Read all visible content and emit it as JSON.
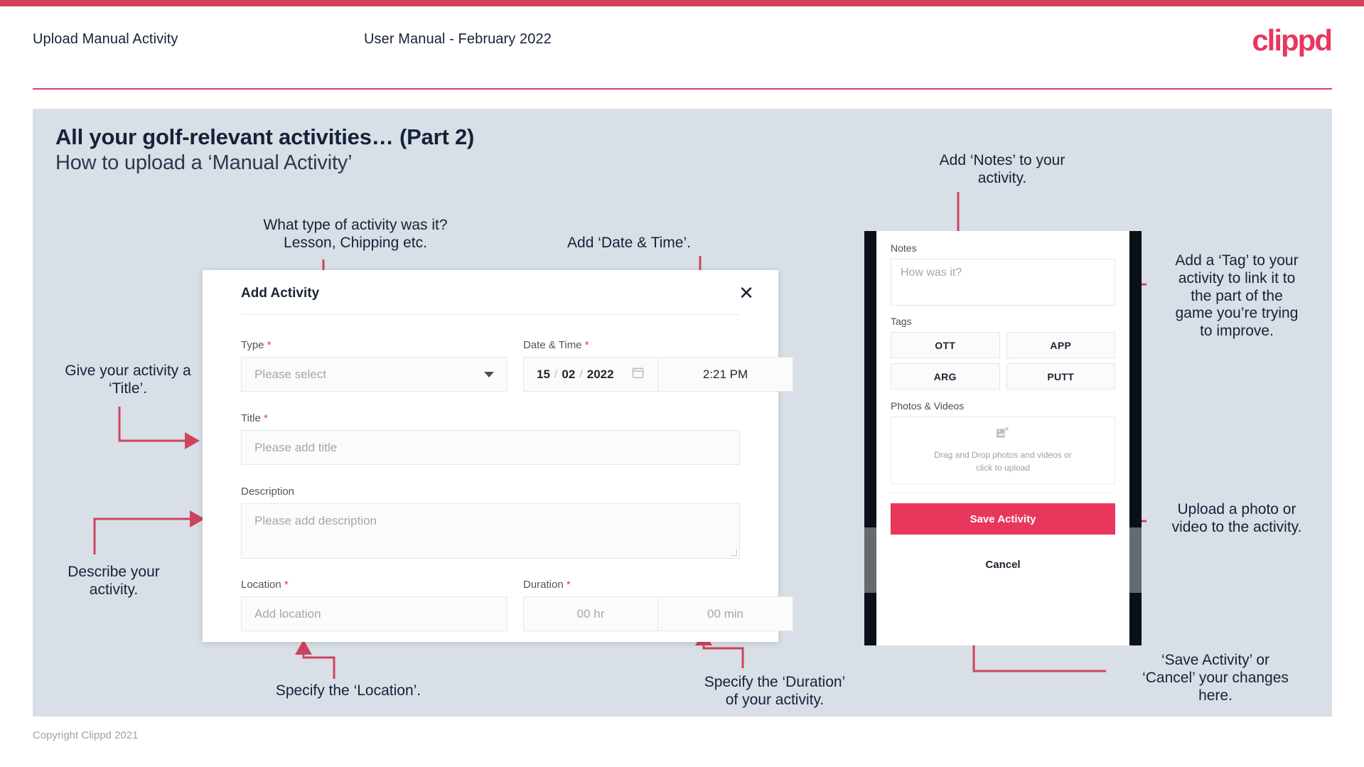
{
  "header": {
    "title": "Upload Manual Activity",
    "subtitle": "User Manual - February 2022",
    "logo": "clippd"
  },
  "slide": {
    "title": "All your golf-relevant activities… (Part 2)",
    "subtitle": "How to upload a ‘Manual Activity’"
  },
  "footer": {
    "copyright": "Copyright Clippd 2021"
  },
  "annotations": {
    "type": "What type of activity was it?\nLesson, Chipping etc.",
    "date_time": "Add ‘Date & Time’.",
    "title": "Give your activity a\n‘Title’.",
    "describe": "Describe your\nactivity.",
    "location": "Specify the ‘Location’.",
    "duration": "Specify the ‘Duration’\nof your activity.",
    "notes": "Add ‘Notes’ to your\nactivity.",
    "tag": "Add a ‘Tag’ to your\nactivity to link it to\nthe part of the\ngame you’re trying\nto improve.",
    "upload": "Upload a photo or\nvideo to the activity.",
    "save_cancel": "‘Save Activity’ or\n‘Cancel’ your changes\nhere."
  },
  "modal": {
    "title": "Add Activity",
    "close_icon": "close-icon",
    "fields": {
      "type": {
        "label": "Type",
        "required": true,
        "placeholder": "Please select",
        "icon": "chevron-down-icon"
      },
      "datetime": {
        "label": "Date & Time",
        "required": true,
        "day": "15",
        "month": "02",
        "year": "2022",
        "sep": "/",
        "calendar_icon": "calendar-icon",
        "time": "2:21 PM"
      },
      "title": {
        "label": "Title",
        "required": true,
        "placeholder": "Please add title"
      },
      "description": {
        "label": "Description",
        "required": false,
        "placeholder": "Please add description"
      },
      "location": {
        "label": "Location",
        "required": true,
        "placeholder": "Add location"
      },
      "duration": {
        "label": "Duration",
        "required": true,
        "hours": "00 hr",
        "minutes": "00 min"
      }
    }
  },
  "phone": {
    "notes": {
      "label": "Notes",
      "placeholder": "How was it?"
    },
    "tags": {
      "label": "Tags",
      "items": [
        "OTT",
        "APP",
        "ARG",
        "PUTT"
      ]
    },
    "photos": {
      "label": "Photos & Videos",
      "icon": "add-image-icon",
      "drop_text": "Drag and Drop photos and videos or\nclick to upload"
    },
    "save_label": "Save Activity",
    "cancel_label": "Cancel"
  },
  "colors": {
    "accent": "#e8365d",
    "accent_dark": "#cf4360",
    "slide_bg": "#d8dfe6",
    "text_dark": "#152238"
  }
}
